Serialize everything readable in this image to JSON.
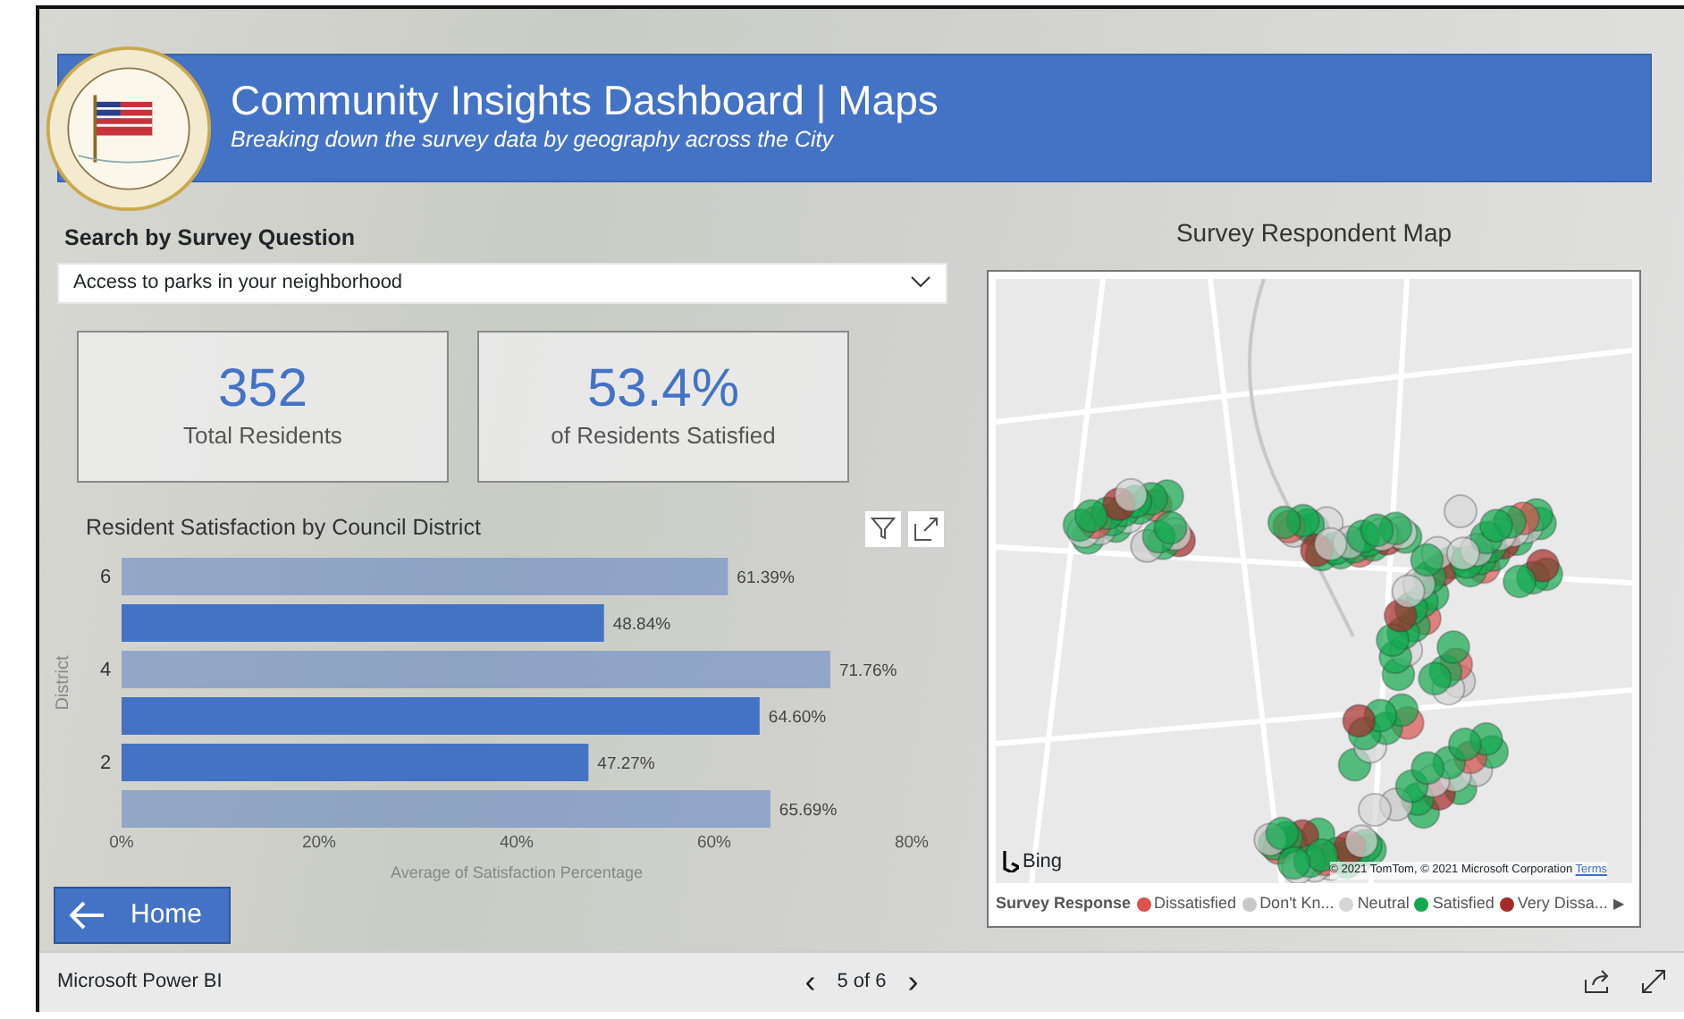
{
  "header": {
    "title": "Community Insights Dashboard | Maps",
    "subtitle": "Breaking down the survey data by geography across the City"
  },
  "search": {
    "label": "Search by Survey Question",
    "value": "Access to parks in your neighborhood"
  },
  "kpis": [
    {
      "value": "352",
      "label": "Total Residents"
    },
    {
      "value": "53.4%",
      "label": "of Residents Satisfied"
    }
  ],
  "bar_chart": {
    "highlighted": [
      false,
      true,
      false,
      true,
      true,
      false
    ],
    "chart_data": {
      "type": "bar",
      "orientation": "horizontal",
      "title": "Resident Satisfaction by Council District",
      "xlabel": "Average of Satisfaction Percentage",
      "ylabel": "District",
      "categories": [
        "6",
        null,
        "4",
        null,
        "2",
        null
      ],
      "series": [
        {
          "color": "#4472c4",
          "values": [
            61.39,
            48.84,
            71.76,
            64.6,
            47.27,
            65.69
          ]
        }
      ],
      "value_labels": [
        "61.39%",
        "48.84%",
        "71.76%",
        "64.60%",
        "47.27%",
        "65.69%"
      ],
      "xlim": [
        0,
        80
      ],
      "xticks": [
        {
          "value": 0,
          "label": "0%"
        },
        {
          "value": 20,
          "label": "20%"
        },
        {
          "value": 40,
          "label": "40%"
        },
        {
          "value": 60,
          "label": "60%"
        },
        {
          "value": 80,
          "label": "80%"
        }
      ]
    }
  },
  "home_button": {
    "label": "Home"
  },
  "map": {
    "title": "Survey Respondent Map",
    "brand": "Bing",
    "copyright": "© 2021 TomTom, © 2021 Microsoft Corporation",
    "terms": "Terms",
    "legend": {
      "title": "Survey Response",
      "items": [
        {
          "label": "Dissatisfied",
          "color": "#d9534f"
        },
        {
          "label": "Don't Kn...",
          "color": "#c8c8c8"
        },
        {
          "label": "Neutral",
          "color": "#d6d6d6"
        },
        {
          "label": "Satisfied",
          "color": "#12a84e"
        },
        {
          "label": "Very Dissa...",
          "color": "#a52a2a"
        }
      ],
      "more": "▶"
    }
  },
  "footer": {
    "brand": "Microsoft Power BI",
    "prev": "‹",
    "page": "5 of 6",
    "next": "›"
  }
}
